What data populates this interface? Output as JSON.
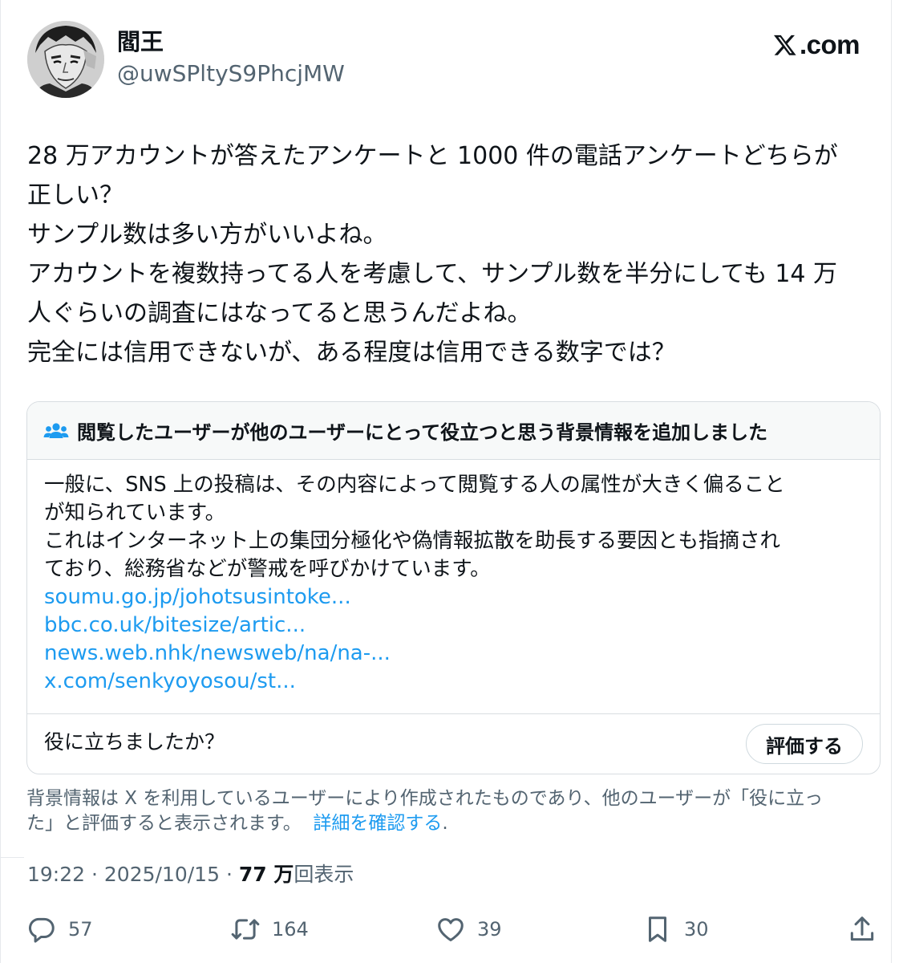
{
  "author": {
    "display_name": "閻王",
    "handle": "@uwSPltyS9PhcjMW"
  },
  "brand": {
    "label": ".com"
  },
  "tweet": {
    "lines": [
      "28 万アカウントが答えたアンケートと 1000 件の電話アンケートどちらが",
      "正しい？",
      "サンプル数は多い方がいいよね。",
      "アカウントを複数持ってる人を考慮して、サンプル数を半分にしても 14 万",
      "人ぐらいの調査にはなってると思うんだよね。",
      "完全には信用できないが、ある程度は信用できる数字では？"
    ]
  },
  "community_note": {
    "header": "閲覧したユーザーが他のユーザーにとって役立つと思う背景情報を追加しました",
    "body_lines": [
      "一般に、SNS 上の投稿は、その内容によって閲覧する人の属性が大きく偏ること",
      "が知られています。",
      "これはインターネット上の集団分極化や偽情報拡散を助長する要因とも指摘され",
      "ており、総務省などが警戒を呼びかけています。"
    ],
    "links": [
      "soumu.go.jp/johotsusintoke...",
      "bbc.co.uk/bitesize/artic...",
      "news.web.nhk/newsweb/na/na-...",
      "x.com/senkyoyosou/st..."
    ],
    "helpful_question": "役に立ちましたか？",
    "rate_button": "評価する"
  },
  "disclaimer": {
    "line1": "背景情報は X を利用しているユーザーにより作成されたものであり、他のユーザーが「役に立っ",
    "line2_text": "た」と評価すると表示されます。",
    "link": "詳細を確認する",
    "line2_end": "."
  },
  "meta": {
    "time": "19:22",
    "dot1": "·",
    "date": "2025/10/15",
    "dot2": "·",
    "views_count": "77 万",
    "views_label": "回表示"
  },
  "actions": {
    "reply_count": "57",
    "retweet_count": "164",
    "like_count": "39",
    "bookmark_count": "30"
  },
  "colors": {
    "text": "#0f1419",
    "secondary": "#536471",
    "link": "#1d9bf0",
    "border": "#d8dde1",
    "note_header_bg": "#f7f9f9"
  },
  "icons": {
    "brand": "x-logo-icon",
    "note": "users-icon",
    "reply": "reply-icon",
    "retweet": "retweet-icon",
    "like": "heart-icon",
    "bookmark": "bookmark-icon",
    "share": "share-icon"
  }
}
